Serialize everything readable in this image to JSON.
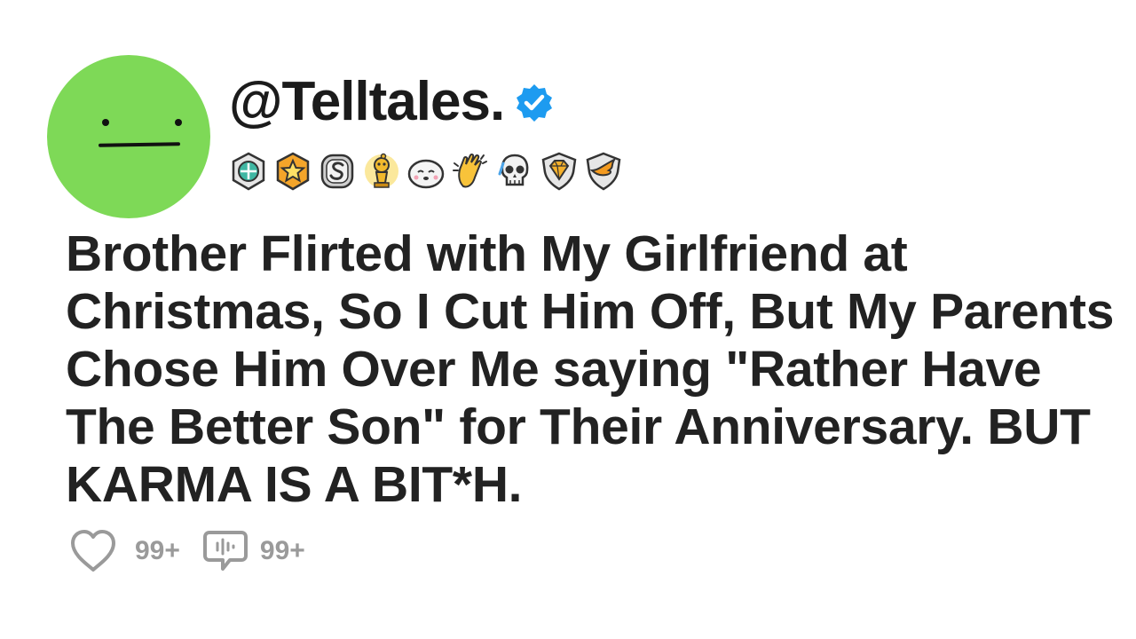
{
  "post": {
    "username": "@Telltales.",
    "title": "Brother Flirted with My Girlfriend at Christmas, So I Cut Him Off, But My Parents Chose Him Over Me saying \"Rather Have The Better Son\" for Their Anniversary. BUT KARMA IS A BIT*H.",
    "likes": "99+",
    "comments": "99+"
  },
  "badges": [
    "compass-badge-icon",
    "star-badge-icon",
    "s-badge-icon",
    "trophy-mascot-badge-icon",
    "sleeping-face-badge-icon",
    "clap-hands-badge-icon",
    "skull-badge-icon",
    "diamond-shield-badge-icon",
    "wing-shield-badge-icon"
  ],
  "colors": {
    "avatar": "#7ed957",
    "verified": "#1d9bf0",
    "title": "#222222",
    "stats": "#9a9a9a"
  }
}
